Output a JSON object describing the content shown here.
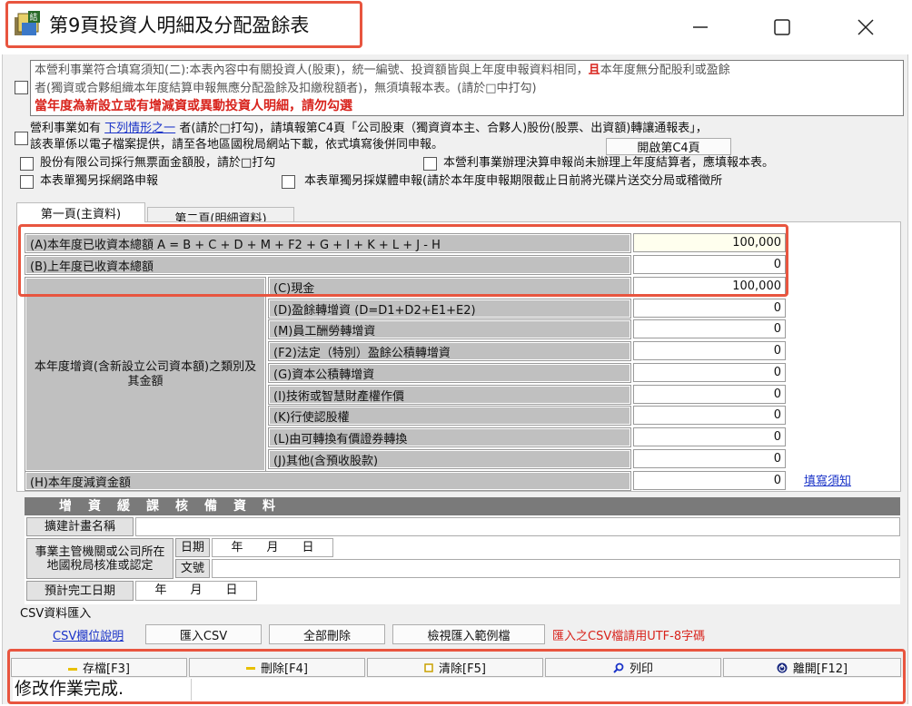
{
  "window": {
    "title": "第9頁投資人明細及分配盈餘表",
    "minimize_glyph": "—",
    "maximize_glyph": "☐",
    "close_glyph": "✕"
  },
  "notice": {
    "line1_a": "本營利事業符合填寫須知(二):本表內容中有關投資人(股東)，統一編號、投資額皆與上年度申報資料相同，",
    "line1_b": "且",
    "line1_c": "本年度無分配股利或盈餘",
    "line2": "者(獨資或合夥組織本年度結算申報無應分配盈餘及扣繳稅額者)，無須填報本表。(請於□中打勾)",
    "line3": "當年度為新設立或有增減資或異動投資人明細，請勿勾選"
  },
  "c4": {
    "line1_a": "營利事業如有",
    "line1_link": "下列情形之一",
    "line1_b": "者(請於□打勾)，請填報第C4頁「公司股東（獨資資本主、合夥人)股份(股票、出資額)轉讓通報表」，",
    "line2": "該表單係以電子檔案提供，請至各地區國稅局網站下載，依式填寫後併同申報。",
    "open_button": "開啟第C4頁"
  },
  "options": {
    "opt1": "股份有限公司採行無票面金額股，請於□打勾",
    "opt2": "本營利事業辦理決算申報尚未辦理上年度結算者，應填報本表。",
    "opt3": "本表單獨另採網路申報",
    "opt4": "本表單獨另採媒體申報(請於本年度申報期限截止日前將光碟片送交分局或稽徵所"
  },
  "tabs": {
    "tab1": "第一頁(主資料)",
    "tab2": "第二頁(明細資料)"
  },
  "capital": {
    "a_label": "(A)本年度已收資本總額 A = B + C + D + M + F2 +  G + I + K + L + J - H",
    "a_value": "100,000",
    "b_label": "(B)上年度已收資本總額",
    "b_value": "0",
    "increase_group_label": "本年度增資(含新設立公司資本額)之類別及其金額",
    "items": [
      {
        "label": "(C)現金",
        "value": "100,000"
      },
      {
        "label": "(D)盈餘轉增資 (D=D1+D2+E1+E2)",
        "value": "0"
      },
      {
        "label": "(M)員工酬勞轉增資",
        "value": "0"
      },
      {
        "label": "(F2)法定（特別）盈餘公積轉增資",
        "value": "0"
      },
      {
        "label": "(G)資本公積轉增資",
        "value": "0"
      },
      {
        "label": "(I)技術或智慧財產權作價",
        "value": "0"
      },
      {
        "label": "(K)行使認股權",
        "value": "0"
      },
      {
        "label": "(L)由可轉換有價證券轉換",
        "value": "0"
      },
      {
        "label": "(J)其他(含預收股款)",
        "value": "0"
      }
    ],
    "h_label": "(H)本年度減資金額",
    "h_value": "0",
    "help_link": "填寫須知"
  },
  "verification": {
    "header": "增資緩課核備資料",
    "plan_label": "擴建計畫名稱",
    "authority_label": "事業主管機關或公司所在地國稅局核准或認定",
    "date_label": "日期",
    "doc_label": "文號",
    "date_parts": "年　　月　　日",
    "completion_label": "預計完工日期",
    "completion_parts": "年　　月　　日"
  },
  "csv": {
    "group_title": "CSV資料匯入",
    "help_link": "CSV欄位說明",
    "import_button": "匯入CSV",
    "delete_all_button": "全部刪除",
    "view_sample_button": "檢視匯入範例檔",
    "note": "匯入之CSV檔請用UTF-8字碼"
  },
  "bottom": {
    "save": "存檔[F3]",
    "delete": "刪除[F4]",
    "clear": "清除[F5]",
    "print": "列印",
    "exit": "離開[F12]",
    "status": "修改作業完成."
  },
  "colors": {
    "highlight": "#e8553f",
    "link": "#1a33c8",
    "warning": "#d8231c",
    "value_highlight": "#ffffee"
  }
}
